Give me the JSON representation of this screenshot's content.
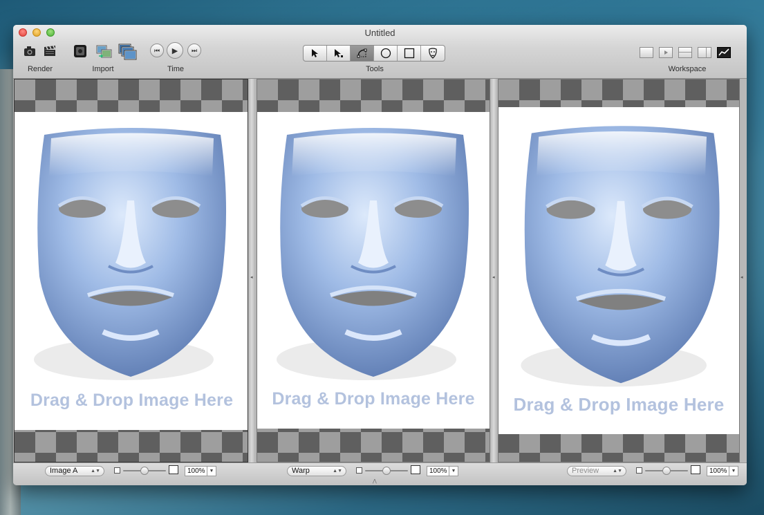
{
  "window": {
    "title": "Untitled"
  },
  "toolbar": {
    "groups": {
      "render": "Render",
      "import": "Import",
      "time": "Time",
      "tools": "Tools",
      "workspace": "Workspace"
    },
    "render_buttons": [
      "camera-icon",
      "clapperboard-icon"
    ],
    "import_buttons": [
      "import-image-a-icon",
      "import-image-b-icon",
      "import-sequence-icon"
    ],
    "time_buttons": [
      "skip-back-icon",
      "play-icon",
      "skip-forward-icon"
    ],
    "tools": [
      {
        "name": "select-arrow-icon",
        "glyph": "➤"
      },
      {
        "name": "select-point-icon",
        "glyph": "➤"
      },
      {
        "name": "curve-tool-icon",
        "glyph": "⌓",
        "active": true
      },
      {
        "name": "ellipse-tool-icon",
        "glyph": "○"
      },
      {
        "name": "rectangle-tool-icon",
        "glyph": "□"
      },
      {
        "name": "face-mask-tool-icon",
        "glyph": "☺"
      }
    ],
    "workspace_buttons": [
      "layout-single-icon",
      "layout-video-icon",
      "layout-split-icon",
      "layout-sidebar-icon",
      "layout-curve-icon"
    ],
    "workspace_active": "layout-curve-icon"
  },
  "panels": [
    {
      "id": "image-a",
      "drop_text": "Drag & Drop Image Here",
      "selector": "Image A",
      "selector_enabled": true,
      "zoom": "100%",
      "zoom_slider": 0.5
    },
    {
      "id": "warp",
      "drop_text": "Drag & Drop Image Here",
      "selector": "Warp",
      "selector_enabled": true,
      "zoom": "100%",
      "zoom_slider": 0.5
    },
    {
      "id": "preview",
      "drop_text": "Drag & Drop Image Here",
      "selector": "Preview",
      "selector_enabled": false,
      "zoom": "100%",
      "zoom_slider": 0.5
    }
  ]
}
